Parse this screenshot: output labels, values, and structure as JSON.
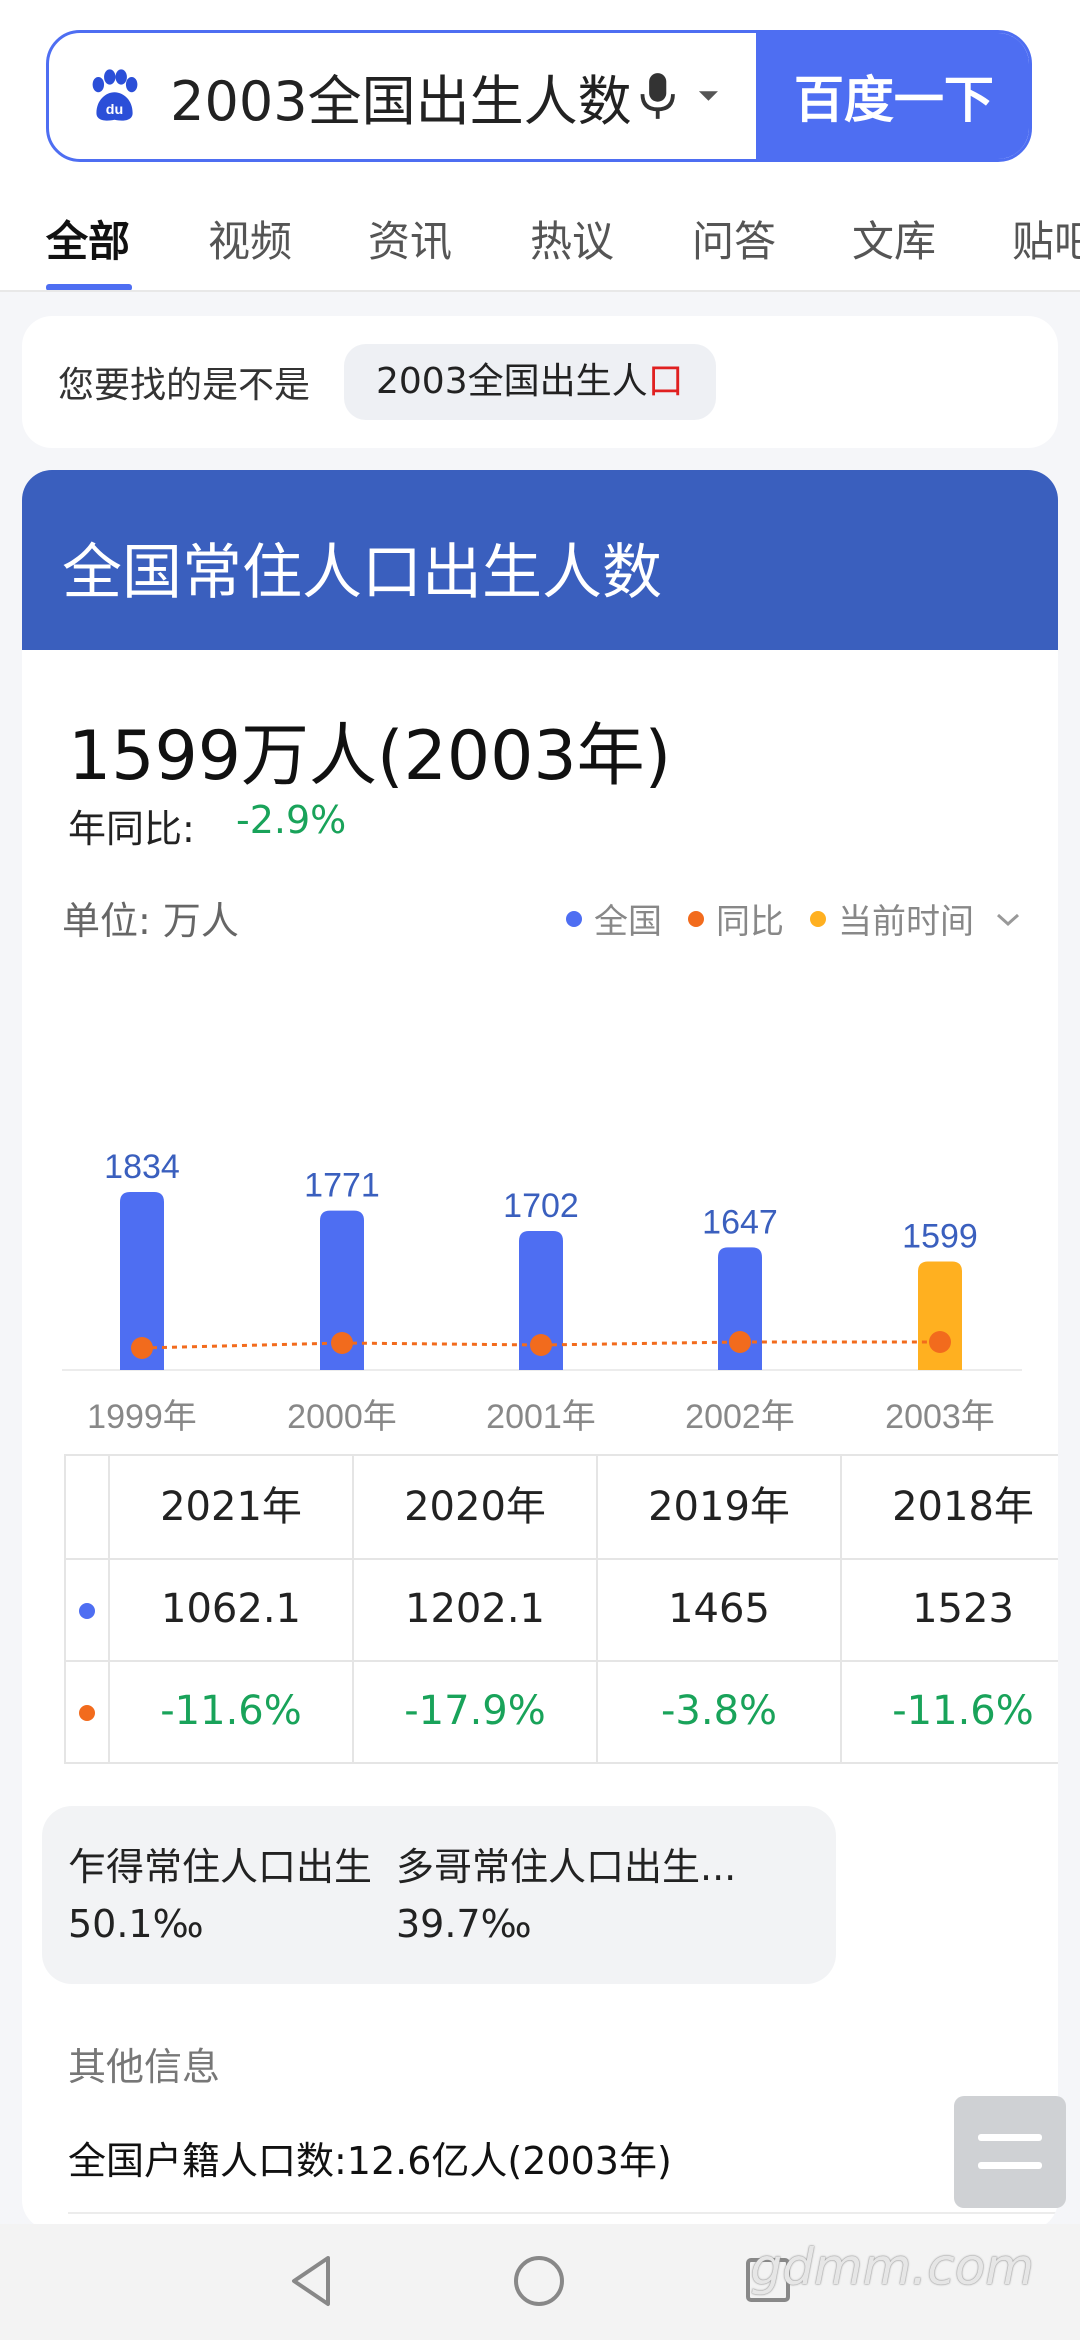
{
  "search": {
    "query": "2003全国出生人数",
    "button_label": "百度一下",
    "colors": {
      "accent": "#4e6ef2"
    }
  },
  "tabs": [
    {
      "label": "全部",
      "active": true
    },
    {
      "label": "视频"
    },
    {
      "label": "资讯"
    },
    {
      "label": "热议"
    },
    {
      "label": "问答"
    },
    {
      "label": "文库"
    },
    {
      "label": "贴吧"
    }
  ],
  "suggestion": {
    "prefix": "您要找的是不是",
    "term_main": "2003全国出生人",
    "term_highlight": "口"
  },
  "card": {
    "title": "全国常住人口出生人数",
    "big_value": "1599万人(2003年)",
    "yoy_label": "年同比:",
    "yoy_value": "-2.9%",
    "unit": "单位: 万人",
    "legend": [
      {
        "label": "全国",
        "color": "#4e6ef2"
      },
      {
        "label": "同比",
        "color": "#f26b1d"
      },
      {
        "label": "当前时间",
        "color": "#ffb020"
      }
    ]
  },
  "chart_data": {
    "type": "bar",
    "categories": [
      "1999年",
      "2000年",
      "2001年",
      "2002年",
      "2003年"
    ],
    "series": [
      {
        "name": "全国",
        "values": [
          1834,
          1771,
          1702,
          1647,
          1599
        ],
        "color": "#4e6ef2"
      },
      {
        "name": "同比",
        "type": "line",
        "values": [
          null,
          null,
          null,
          null,
          null
        ],
        "color": "#f26b1d"
      }
    ],
    "highlight_category": "2003年",
    "highlight_color": "#ffb020",
    "data_labels": [
      "1834",
      "1771",
      "1702",
      "1647",
      "1599"
    ],
    "grid": false
  },
  "table": {
    "years": [
      "2021年",
      "2020年",
      "2019年",
      "2018年"
    ],
    "values": [
      "1062.1",
      "1202.1",
      "1465",
      "1523"
    ],
    "yoy": [
      "-11.6%",
      "-17.9%",
      "-3.8%",
      "-11.6%"
    ],
    "value_marker_color": "#4e6ef2",
    "yoy_marker_color": "#f26b1d"
  },
  "related": [
    {
      "title": "乍得常住人口出生...",
      "value": "50.1‰"
    },
    {
      "title": "多哥常住人口出生...",
      "value": "39.7‰"
    }
  ],
  "other": {
    "label": "其他信息",
    "line": "全国户籍人口数:12.6亿人(2003年)"
  },
  "watermark": "gdmm.com"
}
